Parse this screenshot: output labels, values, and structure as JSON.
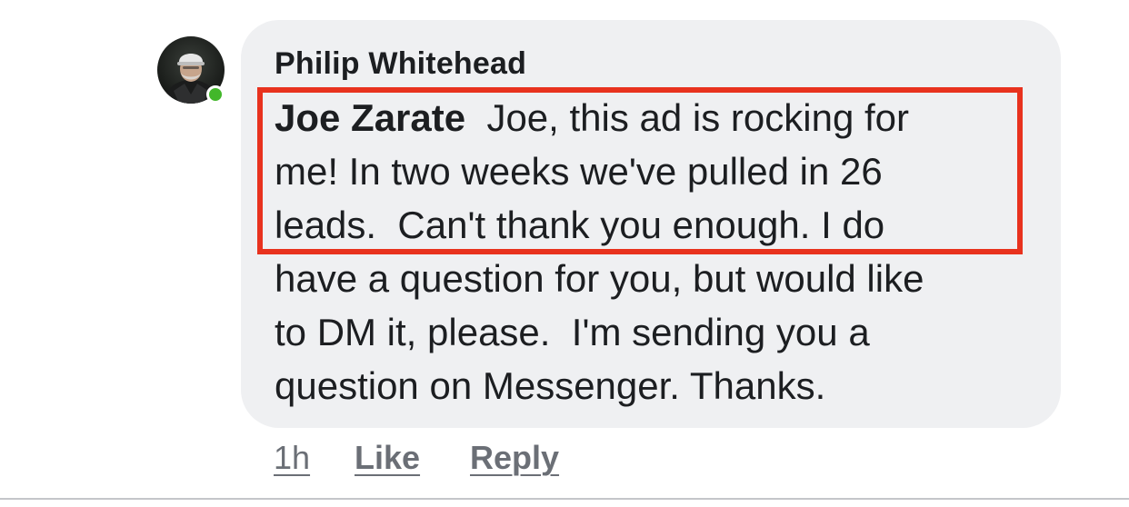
{
  "comment": {
    "author": "Philip Whitehead",
    "mention": "Joe Zarate",
    "lines": [
      "  Joe, this ad is rocking for",
      "me! In two weeks we've pulled in 26",
      "leads.  Can't thank you enough. I do",
      "have a question for you, but would like",
      "to DM it, please.  I'm sending you a",
      "question on Messenger. Thanks."
    ],
    "online_status_color": "#42b72a",
    "highlight_color": "#e8321e"
  },
  "actions": {
    "time": "1h",
    "like": "Like",
    "reply": "Reply"
  },
  "icons": {
    "avatar": "user-avatar-icon",
    "presence": "online-status-icon"
  }
}
